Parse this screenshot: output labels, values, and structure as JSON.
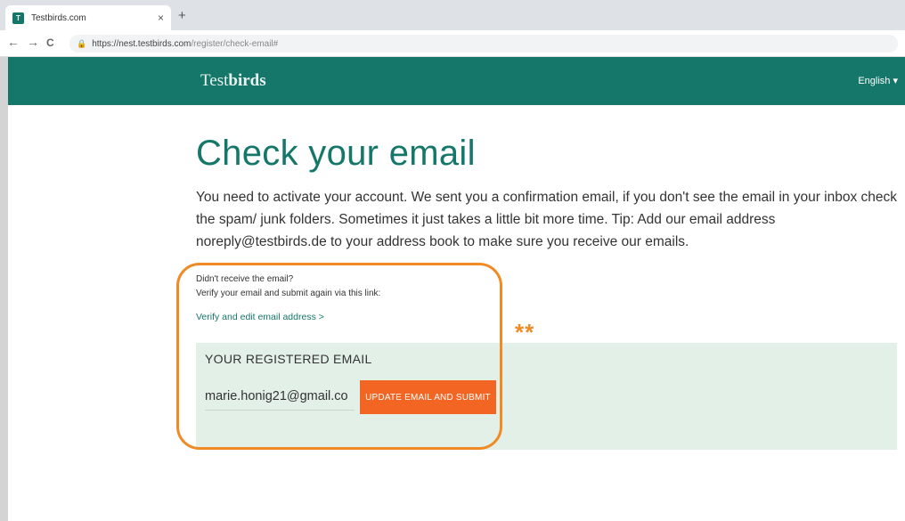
{
  "browser": {
    "tab_title": "Testbirds.com",
    "tab_close": "×",
    "new_tab": "+",
    "back": "←",
    "forward": "→",
    "reload": "C",
    "url_host": "https://nest.testbirds.com",
    "url_path": "/register/check-email#"
  },
  "header": {
    "logo_part1": "Test",
    "logo_part2": "birds",
    "language": "English ▾"
  },
  "main": {
    "title": "Check your email",
    "intro": "You need to activate your account. We sent you a confirmation email, if you don't see the email in your inbox check the spam/ junk folders. Sometimes it just takes a little bit more time. Tip: Add our email address noreply@testbirds.de to your address book to make sure you receive our emails.",
    "helper_line1": "Didn't receive the email?",
    "helper_line2": "Verify your email and submit again via this link:",
    "verify_link": "Verify and edit email address >",
    "panel_label": "YOUR REGISTERED EMAIL",
    "email_value": "marie.honig21@gmail.co",
    "update_button": "UPDATE EMAIL AND SUBMIT"
  },
  "annotation": {
    "marker": "**",
    "color": "#f08a25"
  },
  "colors": {
    "brand": "#15776a",
    "accent": "#f26522",
    "panel": "#e2f0e7"
  }
}
